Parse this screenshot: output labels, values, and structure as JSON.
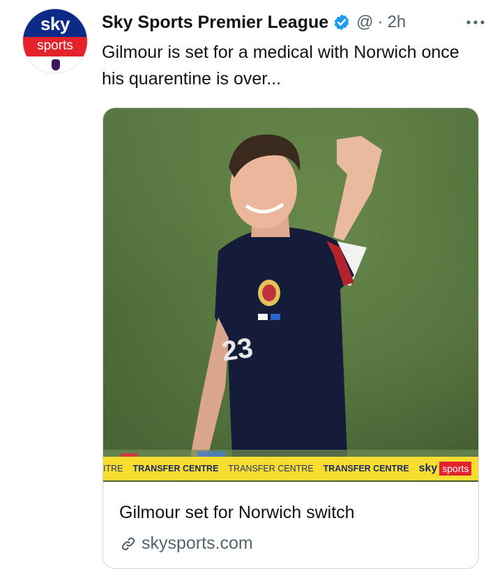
{
  "tweet": {
    "author_name": "Sky Sports Premier League",
    "handle": "@",
    "separator": "·",
    "time": "2h",
    "text": "Gilmour is set for a medical with Norwich once his quarentine is over...",
    "verified": true
  },
  "avatar": {
    "logo_top": "sky",
    "logo_bottom": "sports"
  },
  "card": {
    "title": "Gilmour set for Norwich switch",
    "domain": "skysports.com",
    "ticker": {
      "items": [
        "ITRE",
        "TRANSFER CENTRE",
        "TRANSFER CENTRE",
        "TRANSFER CENTRE"
      ],
      "brand_sky": "sky",
      "brand_sports": "sports"
    },
    "shirt_number": "23"
  },
  "icons": {
    "verified": "verified-badge-icon",
    "more": "more-options-icon",
    "link": "link-icon"
  },
  "colors": {
    "verified_blue": "#1d9bf0",
    "secondary_text": "#536471",
    "sky_blue": "#0c2b88",
    "sky_red": "#e3222b",
    "ticker_yellow": "#f6dd2f"
  }
}
